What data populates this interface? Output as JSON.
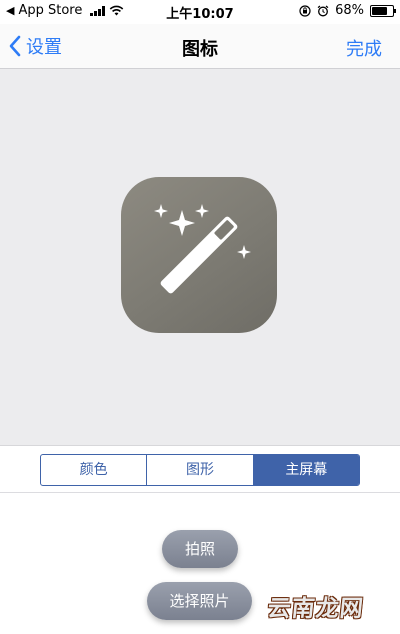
{
  "status_bar": {
    "carrier": "App Store",
    "time": "上午10:07",
    "battery_percent": "68%",
    "battery_level": 0.68
  },
  "nav": {
    "back_label": "设置",
    "title": "图标",
    "done_label": "完成"
  },
  "preview": {
    "icon_name": "magic-wand-icon",
    "icon_colors": [
      "#8d8a81",
      "#6f6d66"
    ]
  },
  "segmented_control": {
    "segments": [
      {
        "label": "颜色",
        "selected": false
      },
      {
        "label": "图形",
        "selected": false
      },
      {
        "label": "主屏幕",
        "selected": true
      }
    ],
    "accent_color": "#3f63a9"
  },
  "actions": {
    "camera_label": "拍照",
    "choose_photo_label": "选择照片"
  },
  "watermark": {
    "text": "云南龙网"
  },
  "colors": {
    "link_blue": "#2e7cf6"
  }
}
